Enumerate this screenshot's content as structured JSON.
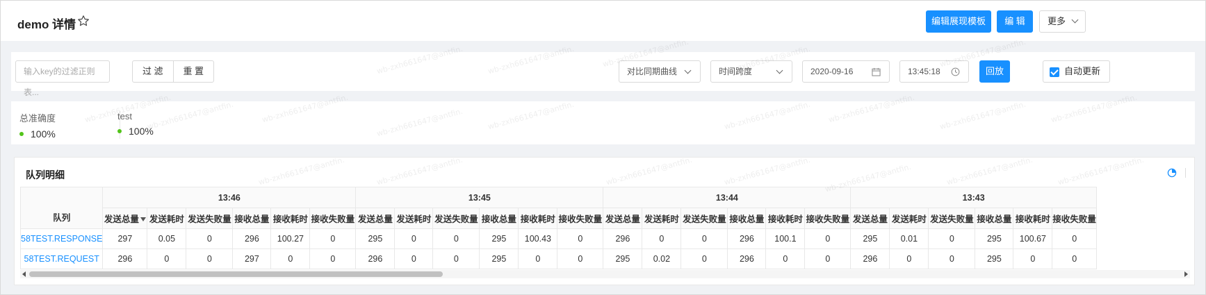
{
  "header": {
    "title": "demo 详情",
    "edit_template_label": "编辑展现模板",
    "edit_label": "编 辑",
    "more_label": "更多"
  },
  "filter": {
    "key_placeholder": "输入key的过滤正则表...",
    "filter_label": "过 滤",
    "reset_label": "重 置",
    "compare_select": "对比同期曲线",
    "span_select": "时间跨度",
    "date_value": "2020-09-16",
    "time_value": "13:45:18",
    "playback_label": "回放",
    "auto_update_label": "自动更新",
    "auto_update_checked": true
  },
  "stats": [
    {
      "label": "总准确度",
      "value": "100%"
    },
    {
      "label": "test",
      "value": "100%"
    }
  ],
  "queue": {
    "title": "队列明细",
    "row_header": "队列",
    "time_groups": [
      "13:46",
      "13:45",
      "13:44",
      "13:43"
    ],
    "metric_headers": [
      "发送总量",
      "发送耗时",
      "发送失败量",
      "接收总量",
      "接收耗时",
      "接收失败量"
    ],
    "sorted_column": "发送总量",
    "rows": [
      {
        "name": "58TEST.RESPONSE",
        "values": [
          "297",
          "0.05",
          "0",
          "296",
          "100.27",
          "0",
          "295",
          "0",
          "0",
          "295",
          "100.43",
          "0",
          "296",
          "0",
          "0",
          "296",
          "100.1",
          "0",
          "295",
          "0.01",
          "0",
          "295",
          "100.67",
          "0"
        ]
      },
      {
        "name": "58TEST.REQUEST",
        "values": [
          "296",
          "0",
          "0",
          "297",
          "0",
          "0",
          "296",
          "0",
          "0",
          "295",
          "0",
          "0",
          "295",
          "0.02",
          "0",
          "296",
          "0",
          "0",
          "296",
          "0",
          "0",
          "295",
          "0",
          "0"
        ]
      }
    ]
  },
  "watermark_text": "wb-zxh661647@antfin.",
  "colors": {
    "primary": "#1890ff",
    "success": "#52c41a",
    "link": "#1890ff"
  }
}
